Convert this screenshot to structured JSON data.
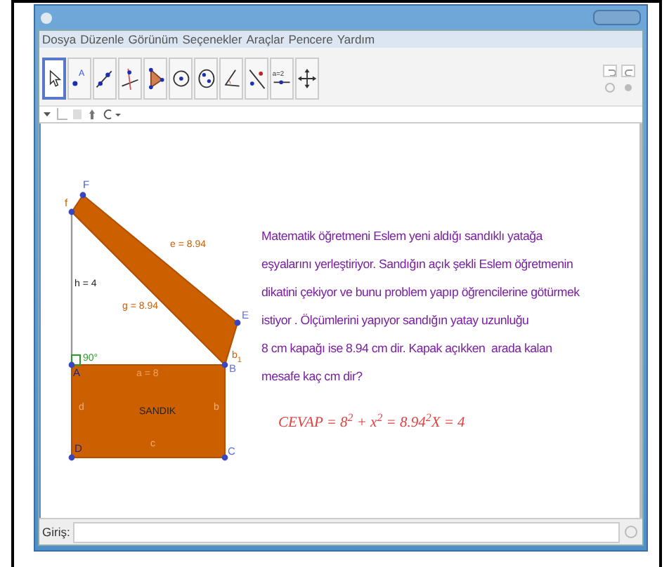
{
  "menu": [
    "Dosya",
    "Düzenle",
    "Görünüm",
    "Seçenekler",
    "Araçlar",
    "Pencere",
    "Yardım"
  ],
  "toolbar": {
    "tools": [
      {
        "kind": "move",
        "selected": true
      },
      {
        "kind": "point",
        "selected": false,
        "glyph": "A"
      },
      {
        "kind": "line",
        "selected": false
      },
      {
        "kind": "perpendicular",
        "selected": false
      },
      {
        "kind": "polygon",
        "selected": false
      },
      {
        "kind": "circle",
        "selected": false
      },
      {
        "kind": "ellipse",
        "selected": false
      },
      {
        "kind": "angle",
        "selected": false
      },
      {
        "kind": "reflect",
        "selected": false
      },
      {
        "kind": "slider",
        "selected": false,
        "glyph": "a=2"
      },
      {
        "kind": "pan",
        "selected": false
      }
    ]
  },
  "drawing": {
    "points": [
      "F",
      "f",
      "A",
      "B",
      "E",
      "D",
      "C"
    ],
    "segment_labels": [
      "e = 8.94",
      "g = 8.94",
      "h = 4",
      "a = 8",
      "d",
      "b",
      "c"
    ],
    "angle_label": "90°",
    "sub_label": "b",
    "sub_index": "1",
    "shape_label": "SANDIK"
  },
  "problem_text": "Matematik öğretmeni Eslem yeni aldığı sandıklı yatağa\neşyalarını yerleştiriyor. Sandığın açık şekli Eslem öğretmenin\ndikatini çekiyor ve bunu problem yapıp öğrencilerine götürmek\nistiyor . Ölçümlerini yapıyor sandığın yatay uzunluğu\n8 cm kapağı ise 8.94 cm dir. Kapak açıkken  arada kalan\nmesafe kaç cm dir?",
  "answer": "CEVAP = 8$^{2}$ + x$^{2}$ = 8.94$^{2}$X = 4",
  "input_bar": {
    "label": "Giriş:"
  }
}
